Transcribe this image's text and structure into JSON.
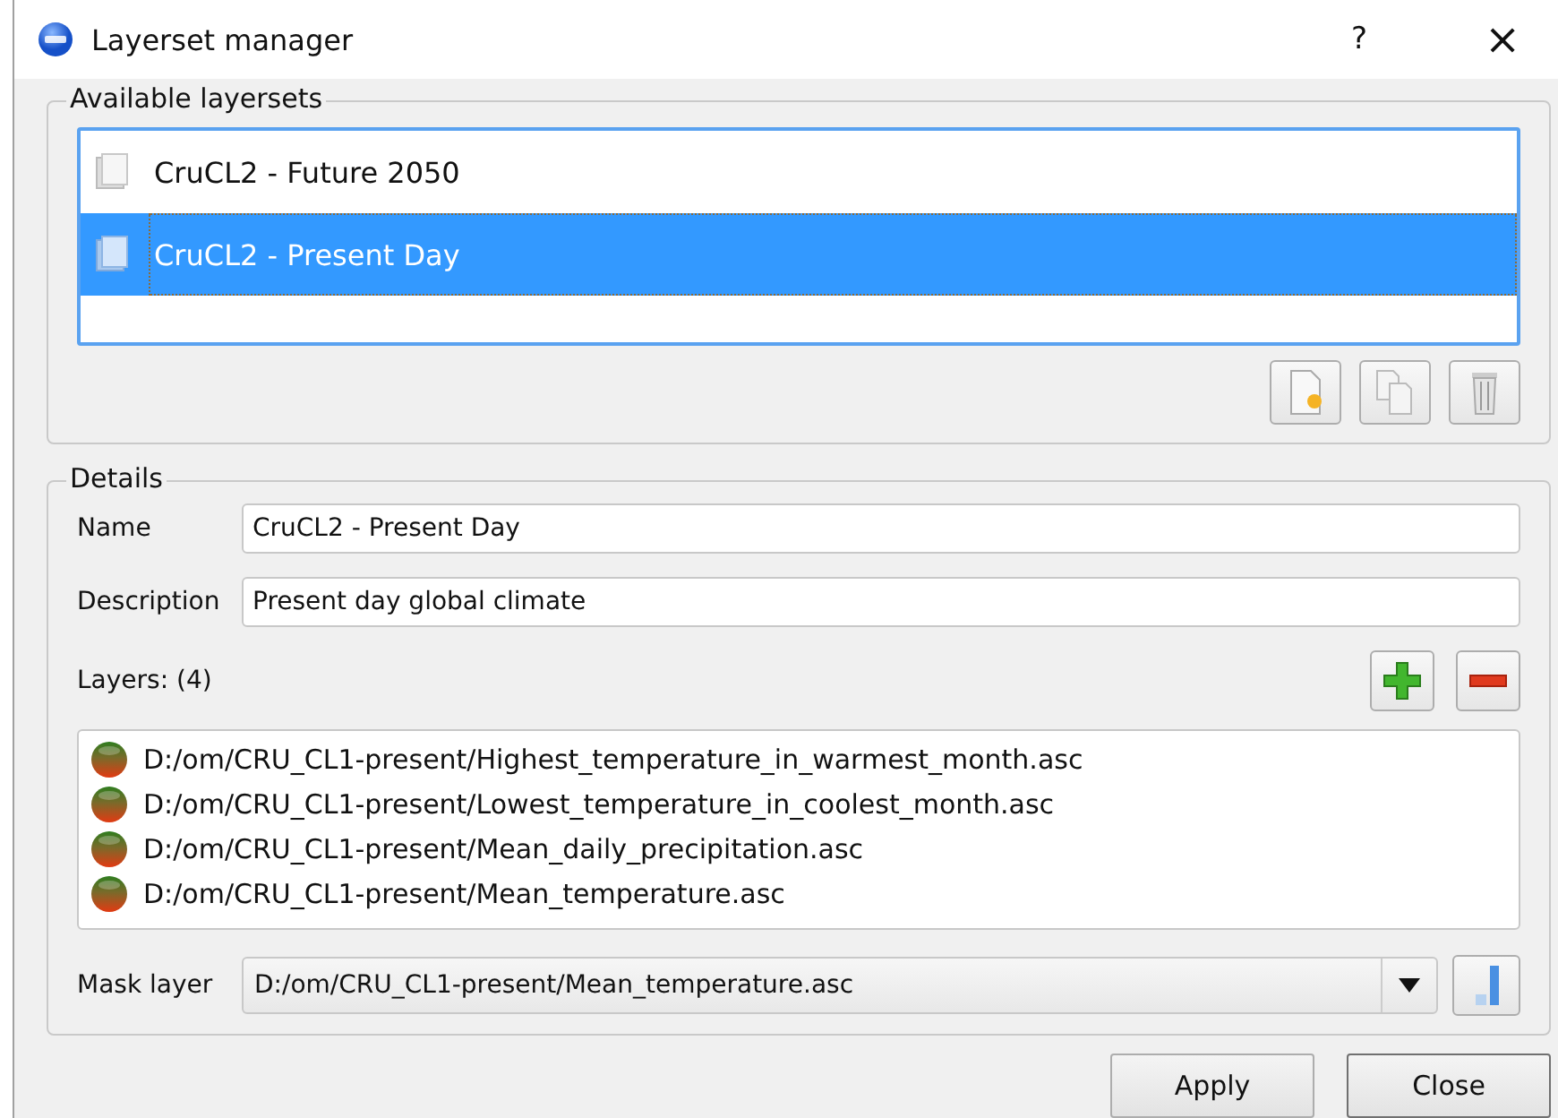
{
  "window": {
    "title": "Layerset manager",
    "help": "?",
    "close": "×"
  },
  "layersets": {
    "title": "Available layersets",
    "items": [
      {
        "label": "CruCL2 - Future 2050",
        "selected": false
      },
      {
        "label": "CruCL2 - Present Day",
        "selected": true
      }
    ]
  },
  "details": {
    "title": "Details",
    "name": {
      "label": "Name",
      "value": "CruCL2 - Present Day"
    },
    "description": {
      "label": "Description",
      "value": "Present day global climate"
    },
    "layers": {
      "label": "Layers: (4)",
      "items": [
        "D:/om/CRU_CL1-present/Highest_temperature_in_warmest_month.asc",
        "D:/om/CRU_CL1-present/Lowest_temperature_in_coolest_month.asc",
        "D:/om/CRU_CL1-present/Mean_daily_precipitation.asc",
        "D:/om/CRU_CL1-present/Mean_temperature.asc"
      ]
    },
    "mask_layer": {
      "label": "Mask layer",
      "value": "D:/om/CRU_CL1-present/Mean_temperature.asc"
    }
  },
  "buttons": [
    "Apply",
    "Close"
  ]
}
